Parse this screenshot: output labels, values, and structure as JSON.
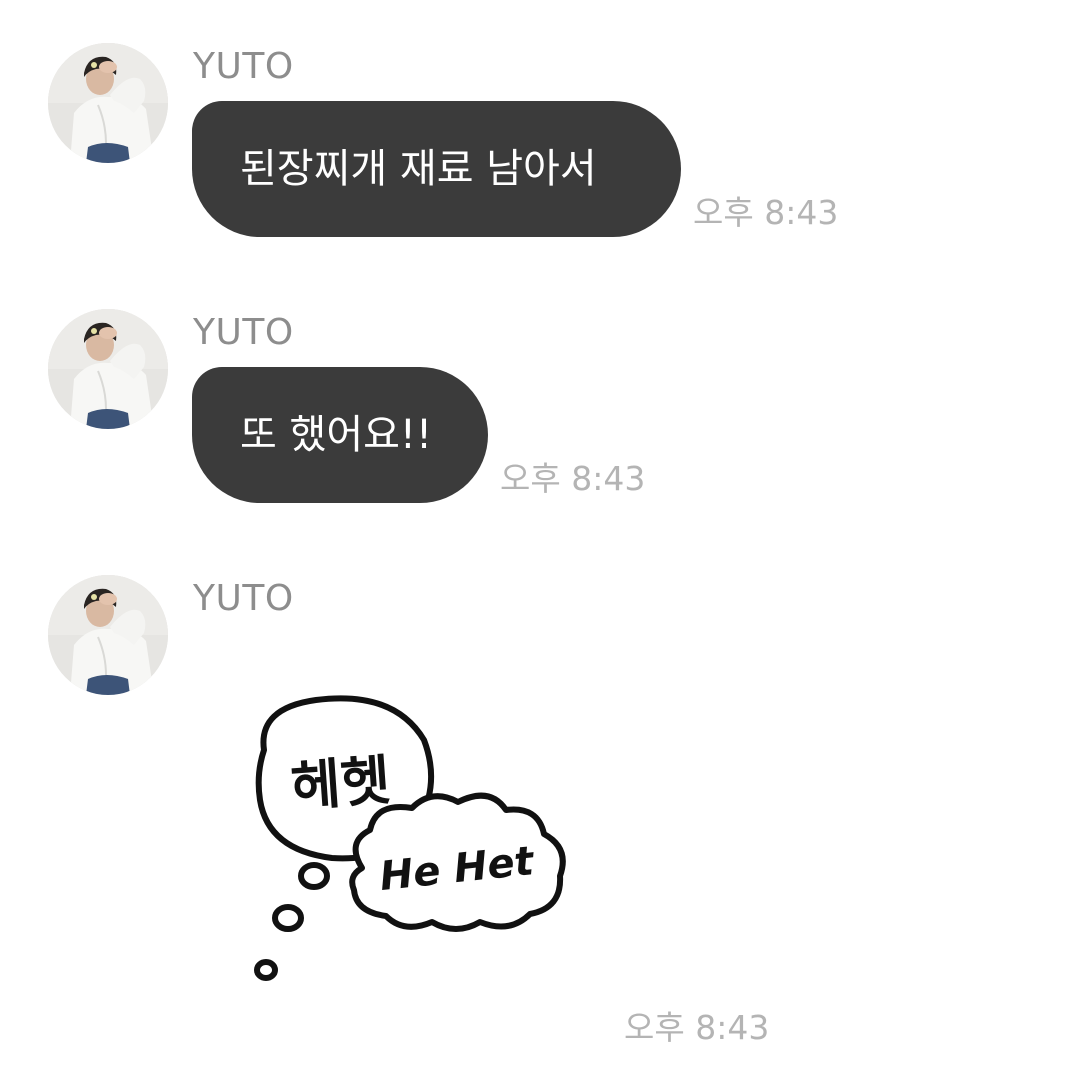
{
  "messages": [
    {
      "sender": "YUTO",
      "text": "된장찌개 재료 남아서",
      "time": "오후 8:43"
    },
    {
      "sender": "YUTO",
      "text": "또 했어요!!",
      "time": "오후 8:43"
    },
    {
      "sender": "YUTO",
      "sticker": {
        "text_korean": "헤헷",
        "text_english": "He Het"
      },
      "time": "오후 8:43"
    }
  ],
  "colors": {
    "bubble_bg": "#3b3b3b",
    "bubble_text": "#ffffff",
    "sender_text": "#8d8d8d",
    "time_text": "#b4b4b4",
    "background": "#ffffff"
  },
  "icons": [
    "avatar-photo",
    "sticker-thought-bubble"
  ]
}
